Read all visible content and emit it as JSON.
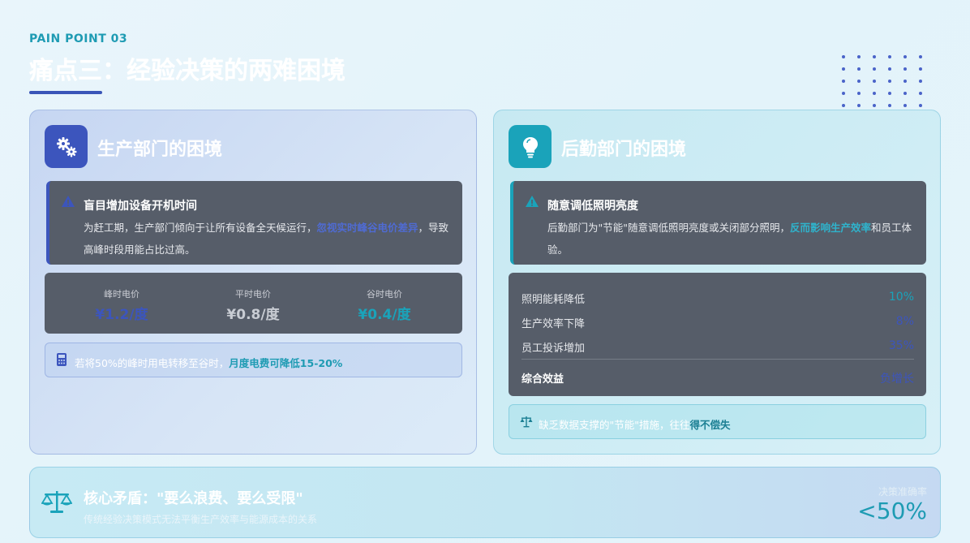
{
  "header": {
    "kicker": "PAIN POINT 03",
    "title": "痛点三：经验决策的两难困境"
  },
  "colors": {
    "accent_blue": "#3c55bd",
    "accent_teal": "#1aa3ba",
    "dark_box": "#565d69"
  },
  "production": {
    "title": "生产部门的困境",
    "icon": "gears-icon",
    "issue": {
      "icon": "warning-icon",
      "title": "盲目增加设备开机时间",
      "text_before": "为赶工期，生产部门倾向于让所有设备全天候运行，",
      "text_highlight": "忽视实时峰谷电价差异",
      "text_after": "，导致高峰时段用能占比过高。"
    },
    "prices": [
      {
        "label": "峰时电价",
        "value": "¥1.2/度",
        "color": "#3c55bd"
      },
      {
        "label": "平时电价",
        "value": "¥0.8/度",
        "color": "#c8ccd3"
      },
      {
        "label": "谷时电价",
        "value": "¥0.4/度",
        "color": "#1aa3ba"
      }
    ],
    "tip": {
      "icon": "calculator-icon",
      "text": "若将50%的峰时用电转移至谷时，",
      "strong": "月度电费可降低15-20%"
    }
  },
  "logistics": {
    "title": "后勤部门的困境",
    "icon": "lightbulb-icon",
    "issue": {
      "icon": "warning-icon",
      "title": "随意调低照明亮度",
      "text_before": "后勤部门为\"节能\"随意调低照明亮度或关闭部分照明，",
      "text_highlight": "反而影响生产效率",
      "text_after": "和员工体验。"
    },
    "impacts": [
      {
        "label": "照明能耗降低",
        "value": "10%",
        "color": "#1aa3ba"
      },
      {
        "label": "生产效率下降",
        "value": "8%",
        "color": "#3c55bd"
      },
      {
        "label": "员工投诉增加",
        "value": "35%",
        "color": "#3c55bd"
      }
    ],
    "summary": {
      "label": "综合效益",
      "value": "负增长",
      "color": "#3c55bd"
    },
    "tip": {
      "icon": "balance-icon",
      "text": "缺乏数据支撑的\"节能\"措施，往往",
      "strong": "得不偿失"
    }
  },
  "core": {
    "icon": "scale-icon",
    "title": "核心矛盾：\"要么浪费、要么受限\"",
    "subtitle": "传统经验决策模式无法平衡生产效率与能源成本的关系",
    "metric_label": "决策准确率",
    "metric_value": "<50%"
  }
}
